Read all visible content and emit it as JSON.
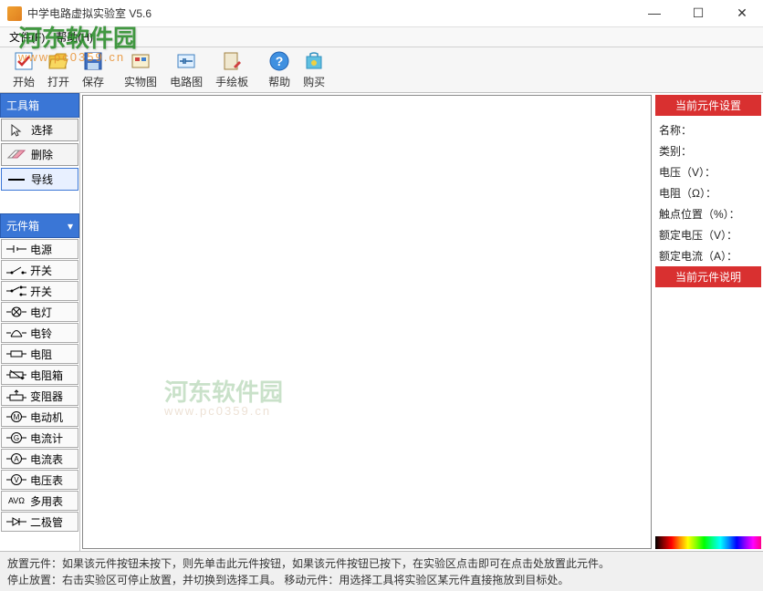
{
  "titlebar": {
    "title": "中学电路虚拟实验室 V5.6"
  },
  "menubar": {
    "file": "文件(F)",
    "help": "帮助(H)"
  },
  "watermark": {
    "main": "河东软件园",
    "sub": "www.pc0359.cn"
  },
  "toolbar": {
    "start": "开始",
    "open": "打开",
    "save": "保存",
    "real": "实物图",
    "circuit": "电路图",
    "draw": "手绘板",
    "help": "帮助",
    "buy": "购买"
  },
  "toolbox": {
    "header": "工具箱",
    "select": "选择",
    "delete": "删除",
    "wire": "导线"
  },
  "compbox": {
    "header": "元件箱",
    "items": [
      {
        "label": "电源"
      },
      {
        "label": "开关"
      },
      {
        "label": "开关"
      },
      {
        "label": "电灯"
      },
      {
        "label": "电铃"
      },
      {
        "label": "电阻"
      },
      {
        "label": "电阻箱"
      },
      {
        "label": "变阻器"
      },
      {
        "label": "电动机"
      },
      {
        "label": "电流计"
      },
      {
        "label": "电流表"
      },
      {
        "label": "电压表"
      },
      {
        "label": "多用表"
      },
      {
        "label": "二极管"
      }
    ],
    "icon_texts": {
      "9": "G",
      "10": "A",
      "11": "V",
      "12": "AVΩ"
    }
  },
  "props": {
    "header1": "当前元件设置",
    "name": "名称：",
    "type": "类别：",
    "voltage": "电压（V）：",
    "resistance": "电阻（Ω）：",
    "contact": "触点位置（%）：",
    "rated_v": "额定电压（V）：",
    "rated_a": "额定电流（A）：",
    "header2": "当前元件说明"
  },
  "status": {
    "line1": "放置元件：如果该元件按钮未按下，则先单击此元件按钮，如果该元件按钮已按下，在实验区点击即可在点击处放置此元件。",
    "line2": "停止放置：右击实验区可停止放置，并切换到选择工具。 移动元件：用选择工具将实验区某元件直接拖放到目标处。"
  }
}
